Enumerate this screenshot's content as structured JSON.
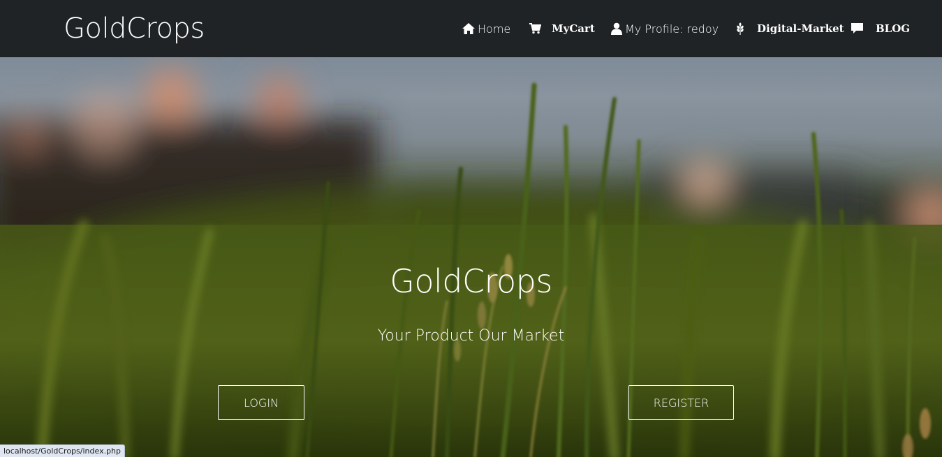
{
  "navbar": {
    "brand": "GoldCrops",
    "items": [
      {
        "label": "Home",
        "icon": "home-icon"
      },
      {
        "label": "MyCart",
        "icon": "cart-icon"
      },
      {
        "label": "My Profile: redoy",
        "icon": "user-icon"
      },
      {
        "label": "Digital-Market",
        "icon": "grain-icon"
      },
      {
        "label": "BLOG",
        "icon": "comment-icon"
      }
    ]
  },
  "hero": {
    "title": "GoldCrops",
    "subtitle": "Your Product Our Market",
    "login_label": "LOGIN",
    "register_label": "REGISTER"
  },
  "status_bar": {
    "url": "localhost/GoldCrops/index.php"
  },
  "colors": {
    "navbar_bg": "#1f2326",
    "text": "#ffffff",
    "status_bg": "#dfe6f1"
  }
}
